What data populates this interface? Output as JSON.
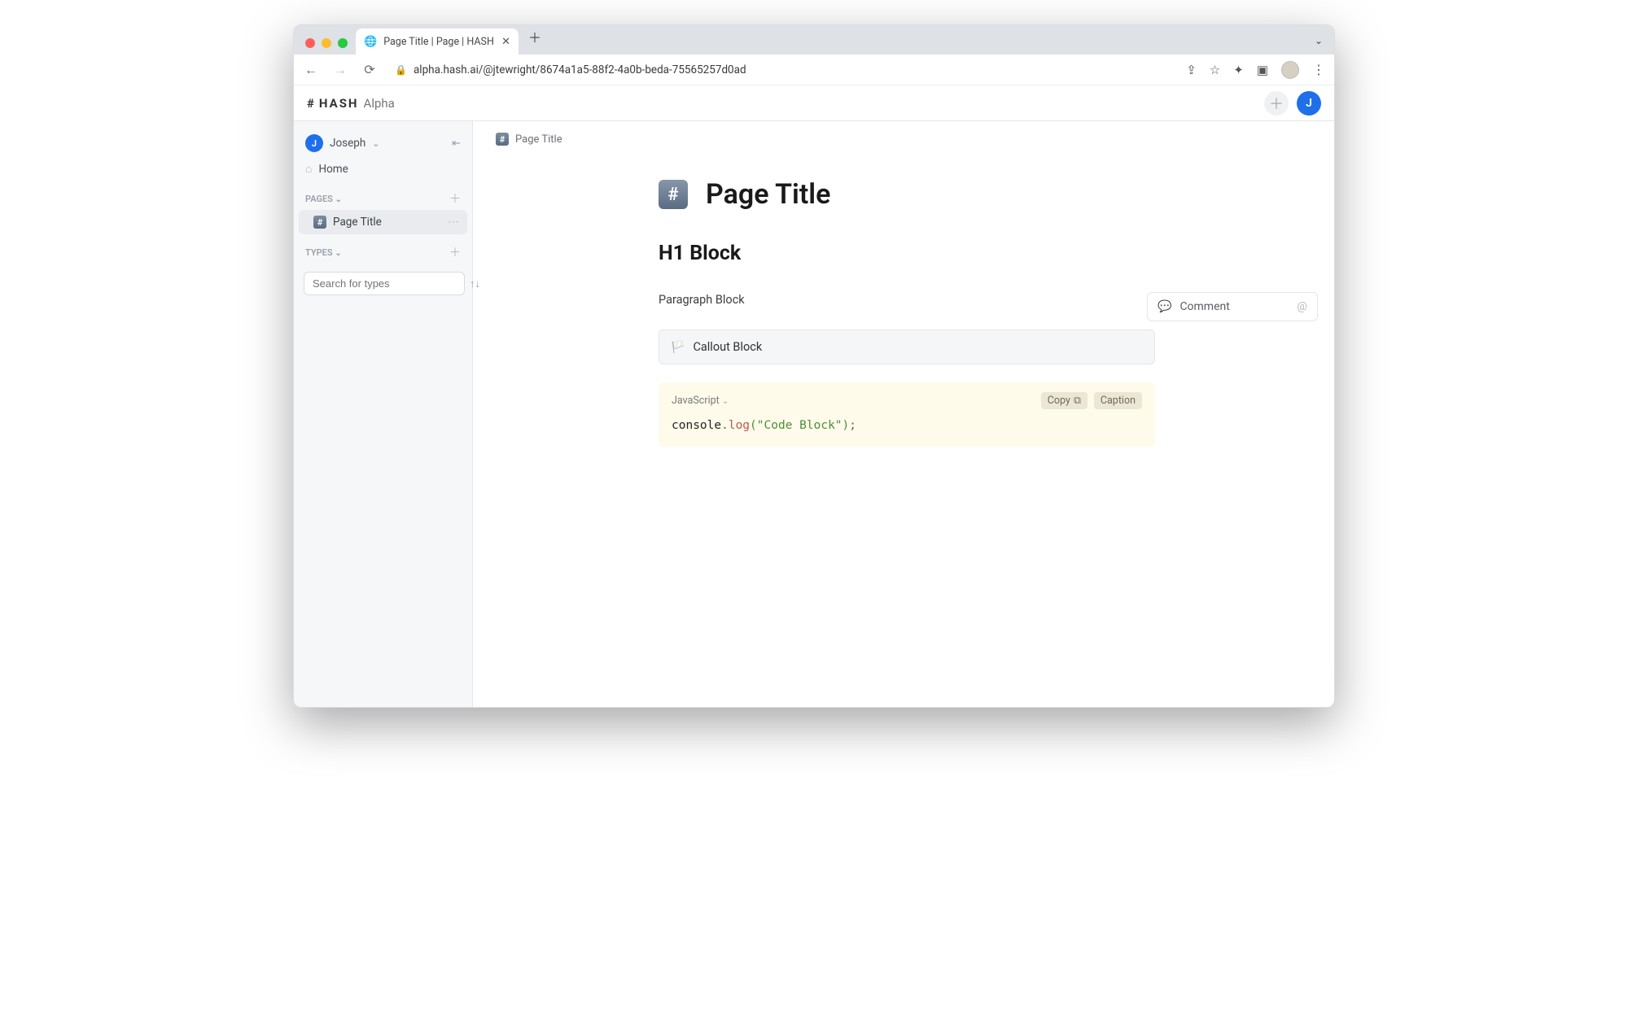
{
  "browser": {
    "tab_title": "Page Title | Page | HASH",
    "url": "alpha.hash.ai/@jtewright/8674a1a5-88f2-4a0b-beda-75565257d0ad"
  },
  "header": {
    "brand": "HASH",
    "suffix": "Alpha",
    "user_initial": "J"
  },
  "sidebar": {
    "user_name": "Joseph",
    "user_initial": "J",
    "home_label": "Home",
    "pages_section": "Pages",
    "types_section": "Types",
    "search_placeholder": "Search for types",
    "page_item_label": "Page Title"
  },
  "breadcrumb": {
    "title": "Page Title"
  },
  "page": {
    "title": "Page Title",
    "h1": "H1 Block",
    "paragraph": "Paragraph Block",
    "callout": "Callout Block"
  },
  "code": {
    "language": "JavaScript",
    "copy_label": "Copy",
    "caption_label": "Caption",
    "tokens": {
      "obj": "console",
      "dot": ".",
      "fn": "log",
      "open": "(",
      "str": "\"Code Block\"",
      "close": ")",
      "semi": ";"
    }
  },
  "comment": {
    "label": "Comment"
  }
}
